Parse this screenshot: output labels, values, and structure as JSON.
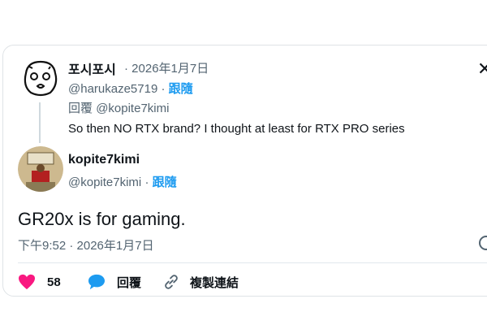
{
  "colors": {
    "accent": "#1d9bf0",
    "like": "#f91880",
    "muted": "#536471",
    "text": "#0f1419"
  },
  "reply": {
    "name": "포시포시",
    "meta": "· 2026年1月7日",
    "handle": "@harukaze5719",
    "sep": "·",
    "follow": "跟隨",
    "reply_to_label": "回覆",
    "reply_to_handle": "@kopite7kimi",
    "text": "So then NO RTX brand? I thought at least for RTX PRO series"
  },
  "main": {
    "name": "kopite7kimi",
    "handle": "@kopite7kimi",
    "sep": "·",
    "follow": "跟隨",
    "text": "GR20x is for gaming.",
    "timestamp": "下午9:52 · 2026年1月7日"
  },
  "actions": {
    "like_count": "58",
    "reply_label": "回覆",
    "copy_link_label": "複製連結"
  },
  "icons": [
    "close-icon",
    "heart-icon",
    "comment-icon",
    "link-icon",
    "info-icon"
  ]
}
